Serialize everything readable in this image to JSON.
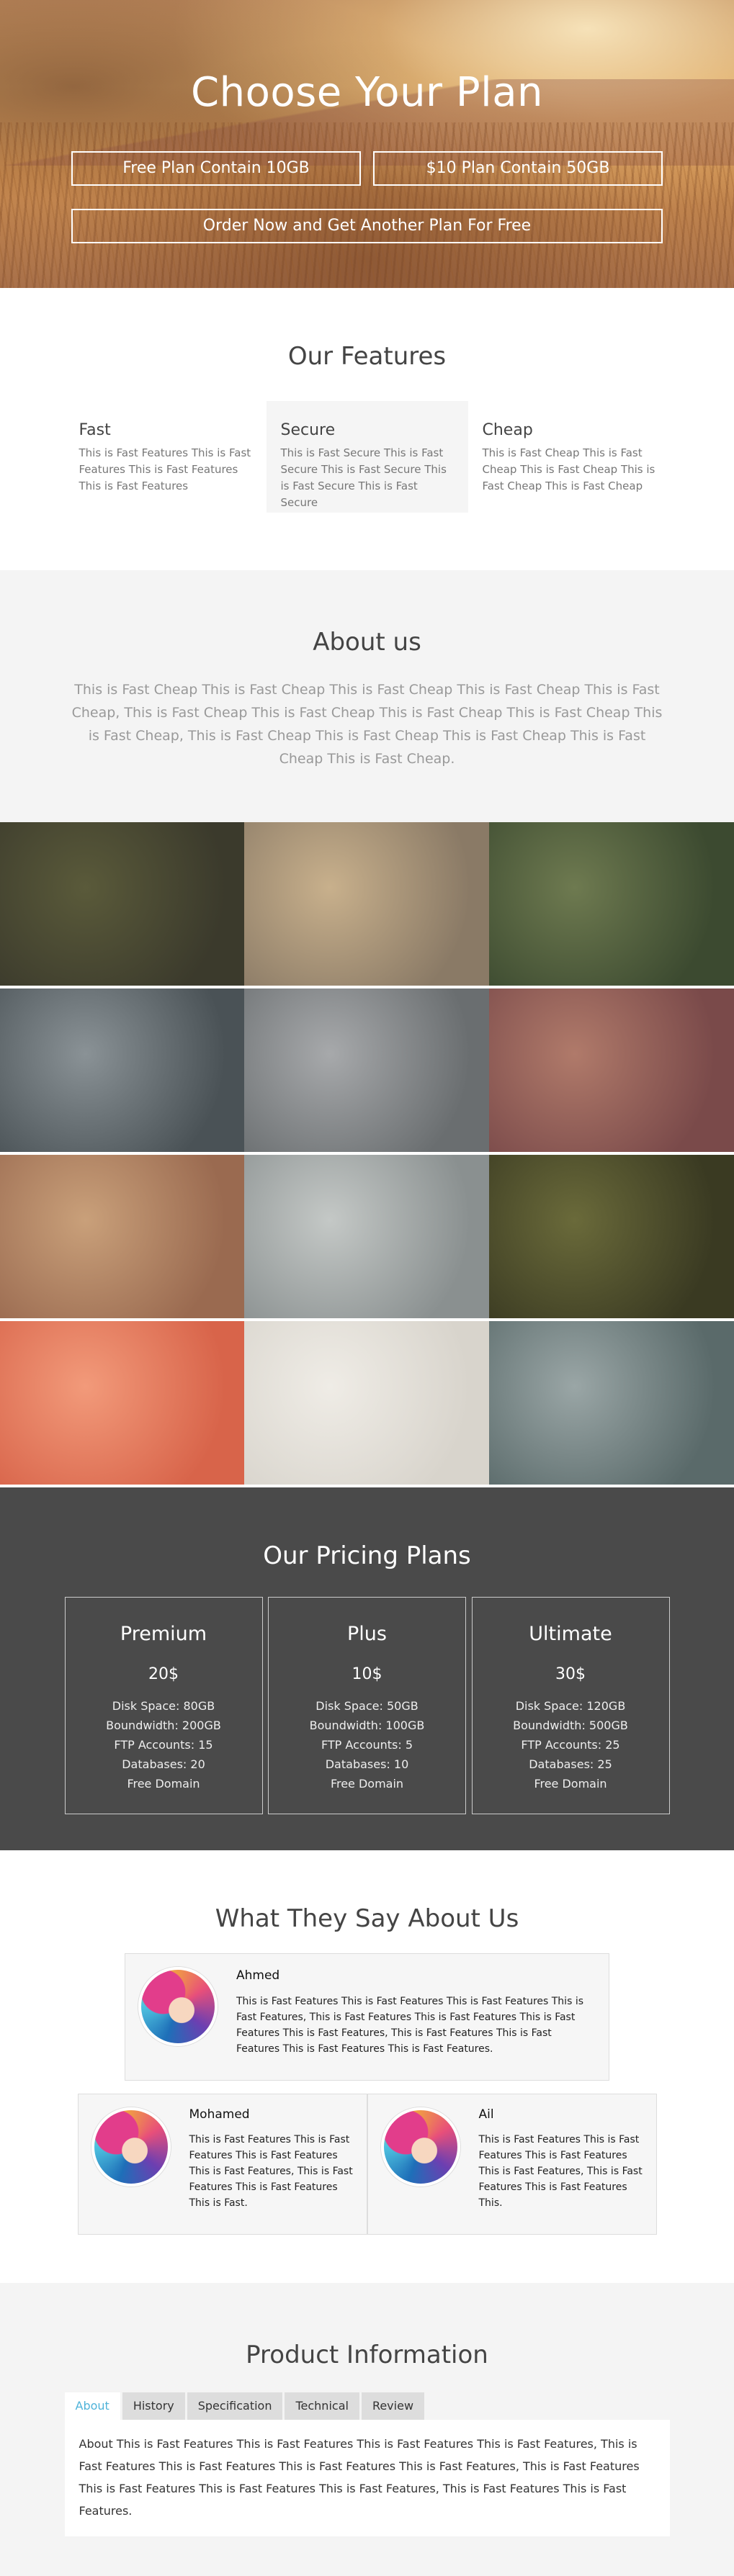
{
  "hero": {
    "title": "Choose Your Plan",
    "buttons": [
      "Free Plan Contain 10GB",
      "$10 Plan Contain 50GB",
      "Order Now and Get Another Plan For Free"
    ]
  },
  "features": {
    "title": "Our Features",
    "items": [
      {
        "title": "Fast",
        "text": "This is Fast Features This is Fast Features This is Fast Features This is Fast Features"
      },
      {
        "title": "Secure",
        "text": "This is Fast Secure This is Fast Secure This is Fast Secure This is Fast Secure This is Fast Secure"
      },
      {
        "title": "Cheap",
        "text": "This is Fast Cheap This is Fast Cheap This is Fast Cheap This is Fast Cheap This is Fast Cheap"
      }
    ]
  },
  "about": {
    "title": "About us",
    "text": "This is Fast Cheap This is Fast Cheap This is Fast Cheap This is Fast Cheap This is Fast Cheap, This is Fast Cheap This is Fast Cheap This is Fast Cheap This is Fast Cheap This is Fast Cheap, This is Fast Cheap This is Fast Cheap This is Fast Cheap This is Fast Cheap This is Fast Cheap."
  },
  "gallery": {
    "colors": [
      [
        "#3b3a2c",
        "#5a5a3a"
      ],
      [
        "#8a7a66",
        "#c8b08c"
      ],
      [
        "#3c4a30",
        "#6e7a50"
      ],
      [
        "#4a5256",
        "#8a9296"
      ],
      [
        "#6a6e70",
        "#a7a9ab"
      ],
      [
        "#7a4a4a",
        "#b07a6a"
      ],
      [
        "#9a6a50",
        "#c9a07a"
      ],
      [
        "#8a9090",
        "#c4c8c6"
      ],
      [
        "#3a3a22",
        "#6a6a3a"
      ],
      [
        "#d8644a",
        "#f29a7a"
      ],
      [
        "#d8d4cc",
        "#efece6"
      ],
      [
        "#5a6a6a",
        "#9aa6a6"
      ]
    ]
  },
  "pricing": {
    "title": "Our Pricing Plans",
    "plans": [
      {
        "name": "Premium",
        "price": "20$",
        "features": [
          "Disk Space: 80GB",
          "Boundwidth: 200GB",
          "FTP Accounts: 15",
          "Databases: 20",
          "Free Domain"
        ]
      },
      {
        "name": "Plus",
        "price": "10$",
        "features": [
          "Disk Space: 50GB",
          "Boundwidth: 100GB",
          "FTP Accounts: 5",
          "Databases: 10",
          "Free Domain"
        ]
      },
      {
        "name": "Ultimate",
        "price": "30$",
        "features": [
          "Disk Space: 120GB",
          "Boundwidth: 500GB",
          "FTP Accounts: 25",
          "Databases: 25",
          "Free Domain"
        ]
      }
    ]
  },
  "testimonials": {
    "title": "What They Say About Us",
    "items": [
      {
        "name": "Ahmed",
        "text": "This is Fast Features This is Fast Features This is Fast Features This is Fast Features, This is Fast Features This is Fast Features This is Fast Features This is Fast Features, This is Fast Features This is Fast Features This is Fast Features This is Fast Features."
      },
      {
        "name": "Mohamed",
        "text": "This is Fast Features This is Fast Features This is Fast Features This is Fast Features, This is Fast Features This is Fast Features This is Fast."
      },
      {
        "name": "Ail",
        "text": "This is Fast Features This is Fast Features This is Fast Features This is Fast Features, This is Fast Features This is Fast Features This."
      }
    ]
  },
  "product": {
    "title": "Product Information",
    "tabs": [
      "About",
      "History",
      "Specification",
      "Technical",
      "Review"
    ],
    "active_tab": "About",
    "content": "About This is Fast Features This is Fast Features This is Fast Features This is Fast Features, This is Fast Features This is Fast Features This is Fast Features This is Fast Features, This is Fast Features This is Fast Features This is Fast Features This is Fast Features, This is Fast Features This is Fast Features."
  }
}
